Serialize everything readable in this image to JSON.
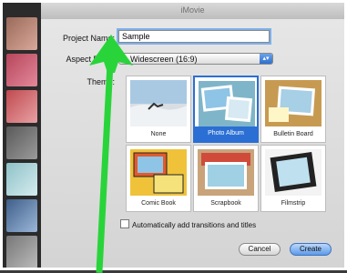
{
  "window": {
    "title": "iMovie"
  },
  "dialog": {
    "project_name_label": "Project Name:",
    "project_name_value": "Sample",
    "aspect_ratio_label": "Aspect Ratio:",
    "aspect_ratio_value": "Widescreen (16:9)",
    "theme_label": "Theme:",
    "themes": [
      {
        "label": "None",
        "selected": false
      },
      {
        "label": "Photo Album",
        "selected": true
      },
      {
        "label": "Bulletin Board",
        "selected": false
      },
      {
        "label": "Comic Book",
        "selected": false
      },
      {
        "label": "Scrapbook",
        "selected": false
      },
      {
        "label": "Filmstrip",
        "selected": false
      }
    ],
    "auto_transitions_label": "Automatically add transitions and titles",
    "cancel_label": "Cancel",
    "create_label": "Create"
  },
  "annotation": {
    "arrow_color": "#29d43a"
  }
}
